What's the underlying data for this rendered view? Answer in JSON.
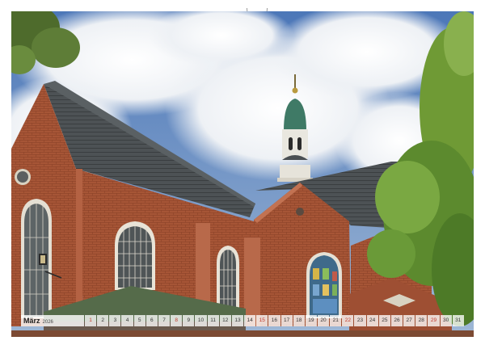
{
  "calendar": {
    "month": "März",
    "year": "2026",
    "days": [
      "1",
      "2",
      "3",
      "4",
      "5",
      "6",
      "7",
      "8",
      "9",
      "10",
      "11",
      "12",
      "13",
      "14",
      "15",
      "16",
      "17",
      "18",
      "19",
      "20",
      "21",
      "22",
      "23",
      "24",
      "25",
      "26",
      "27",
      "28",
      "29",
      "30",
      "31"
    ],
    "sundays": [
      "1",
      "8",
      "15",
      "22",
      "29"
    ]
  },
  "photo": {
    "subject": "brick-church-with-green-copper-spire"
  },
  "colors": {
    "brick": "#a9583a",
    "sky": "#3f6fb6",
    "roof": "#4a4f52",
    "spire": "#3f7a66",
    "foliage": "#5c8a2e"
  }
}
